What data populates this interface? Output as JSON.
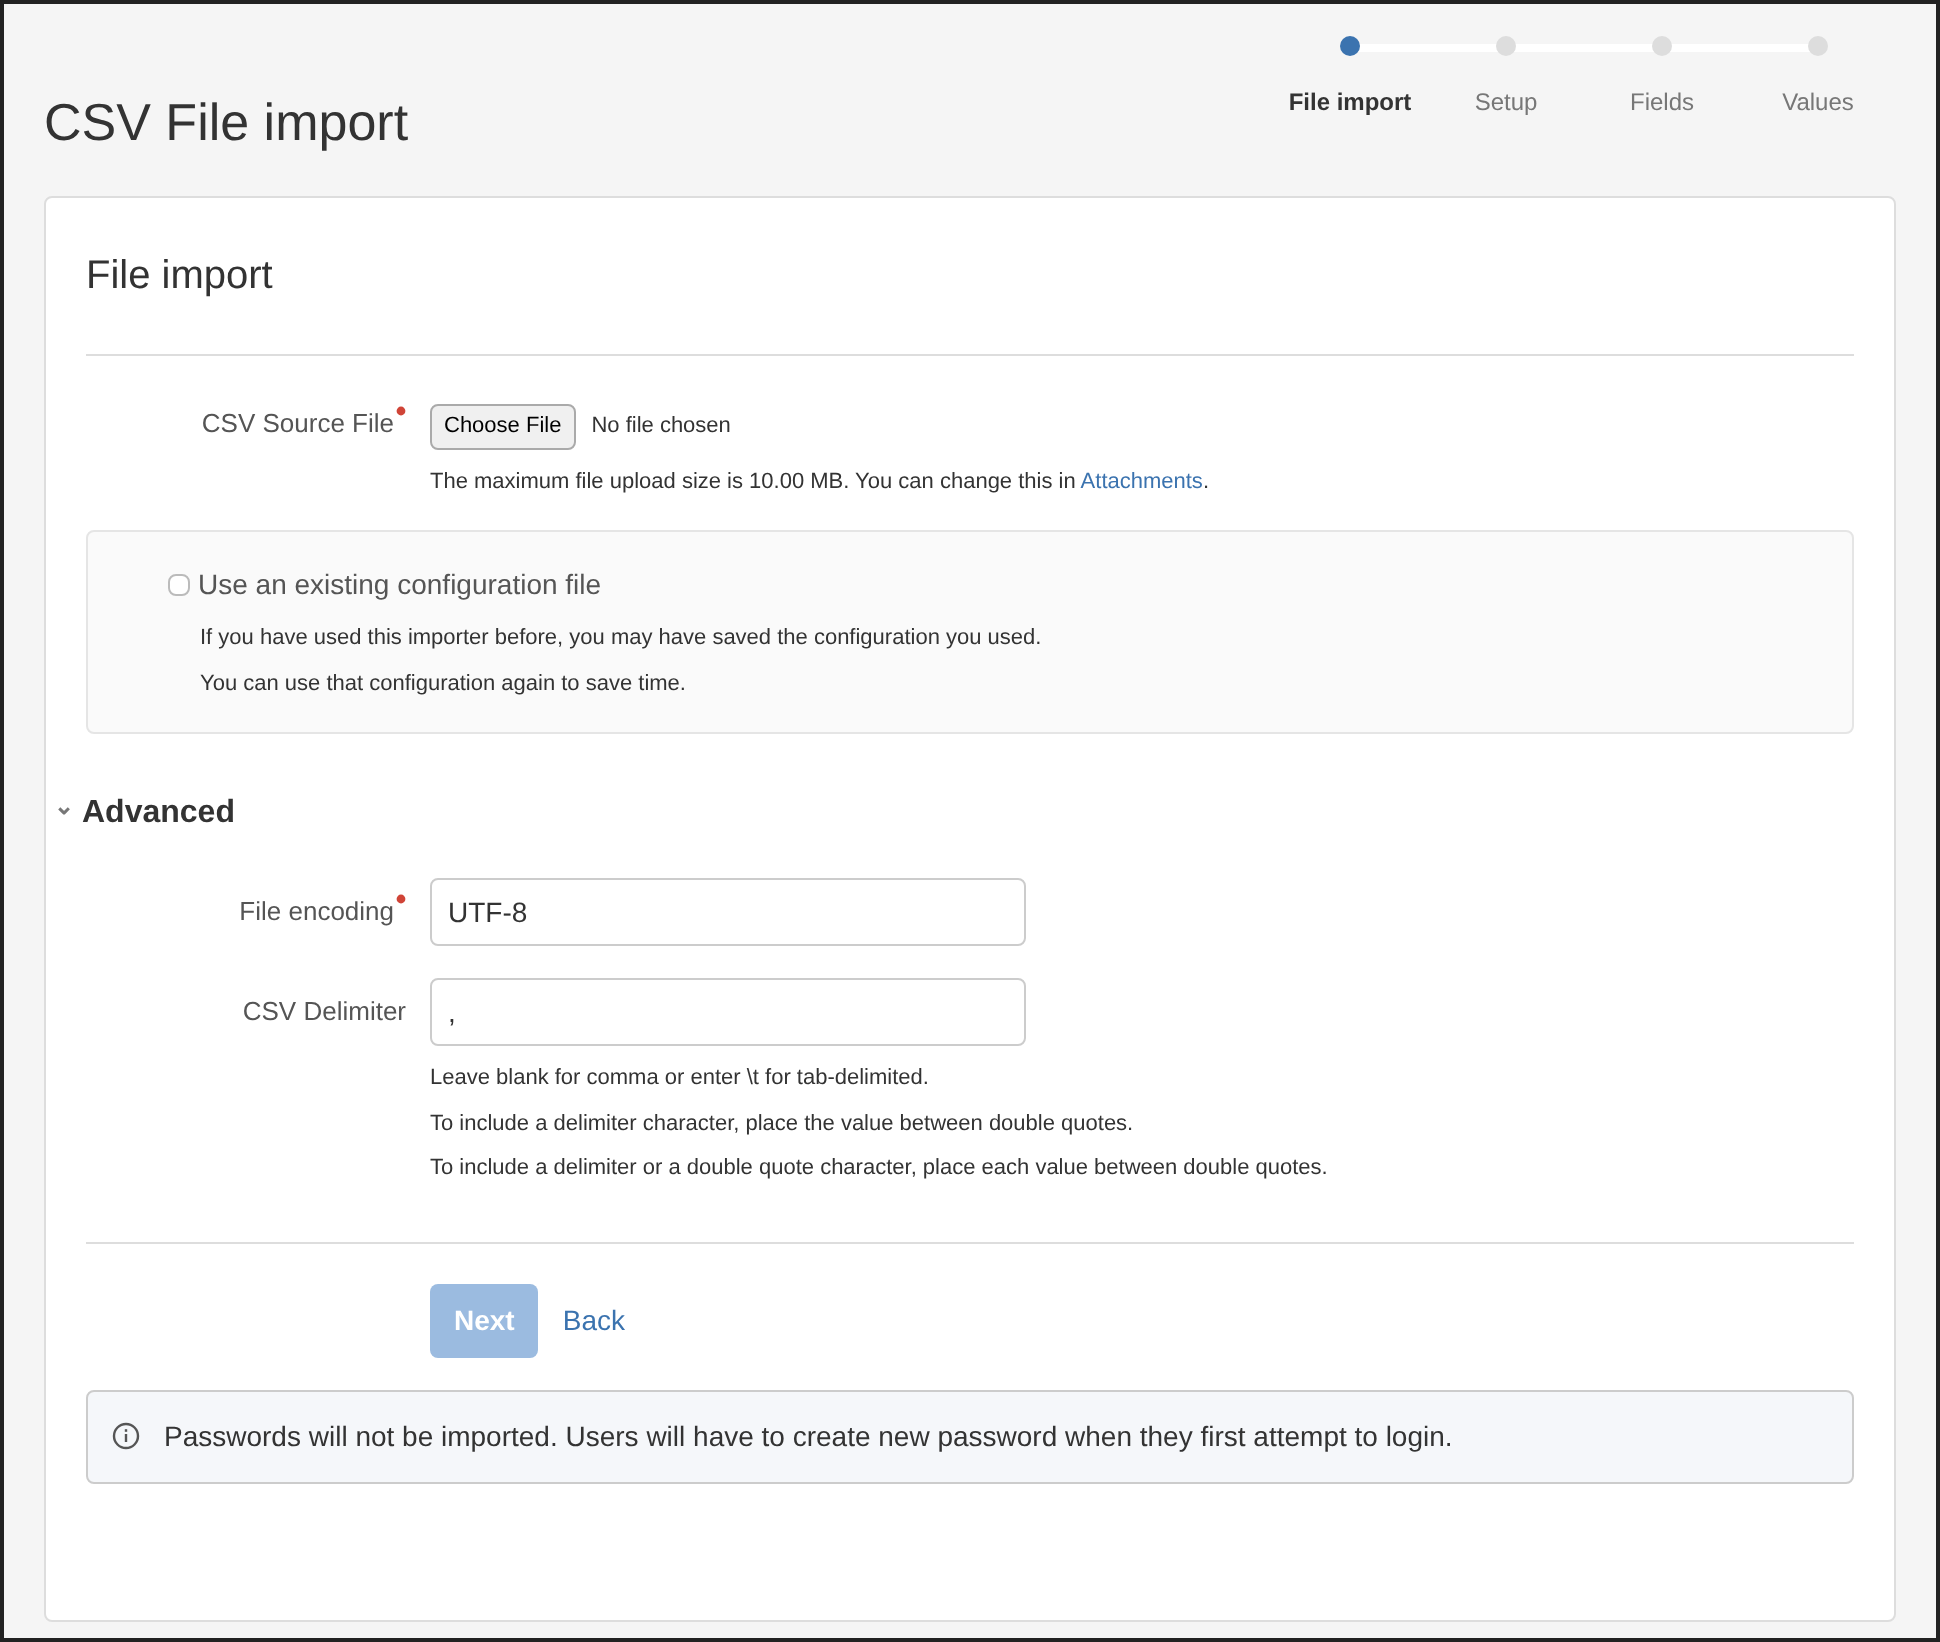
{
  "page_title": "CSV File import",
  "steps": [
    {
      "label": "File import",
      "selected": true
    },
    {
      "label": "Setup",
      "selected": false
    },
    {
      "label": "Fields",
      "selected": false
    },
    {
      "label": "Values",
      "selected": false
    }
  ],
  "card_title": "File import",
  "source_file": {
    "label": "CSV Source File",
    "required": true,
    "button": "Choose File",
    "status": "No file chosen",
    "help": "The maximum file upload size is 10.00 MB. You can change this in ",
    "help_link": "Attachments",
    "help_end": "."
  },
  "config": {
    "label": "Use an existing configuration file",
    "checked": false,
    "help": [
      "If you have used this importer before, you may have saved the configuration you used.",
      "You can use that configuration again to save time."
    ]
  },
  "advanced": {
    "title": "Advanced",
    "expanded": true,
    "caret": "⌄",
    "fields": [
      {
        "label": "File encoding",
        "required": true,
        "value": "UTF-8"
      },
      {
        "label": "CSV Delimiter",
        "required": false,
        "value": ","
      }
    ],
    "help": [
      "Leave blank for comma or enter \\t for tab-delimited.",
      "To include a delimiter character, place the value between double quotes.",
      "To include a delimiter or a double quote character, place each value between double quotes."
    ]
  },
  "buttons": {
    "next": "Next",
    "next_disabled": true,
    "back": "Back"
  },
  "notice": "Passwords will not be imported. Users will have to create new password when they first attempt to login."
}
